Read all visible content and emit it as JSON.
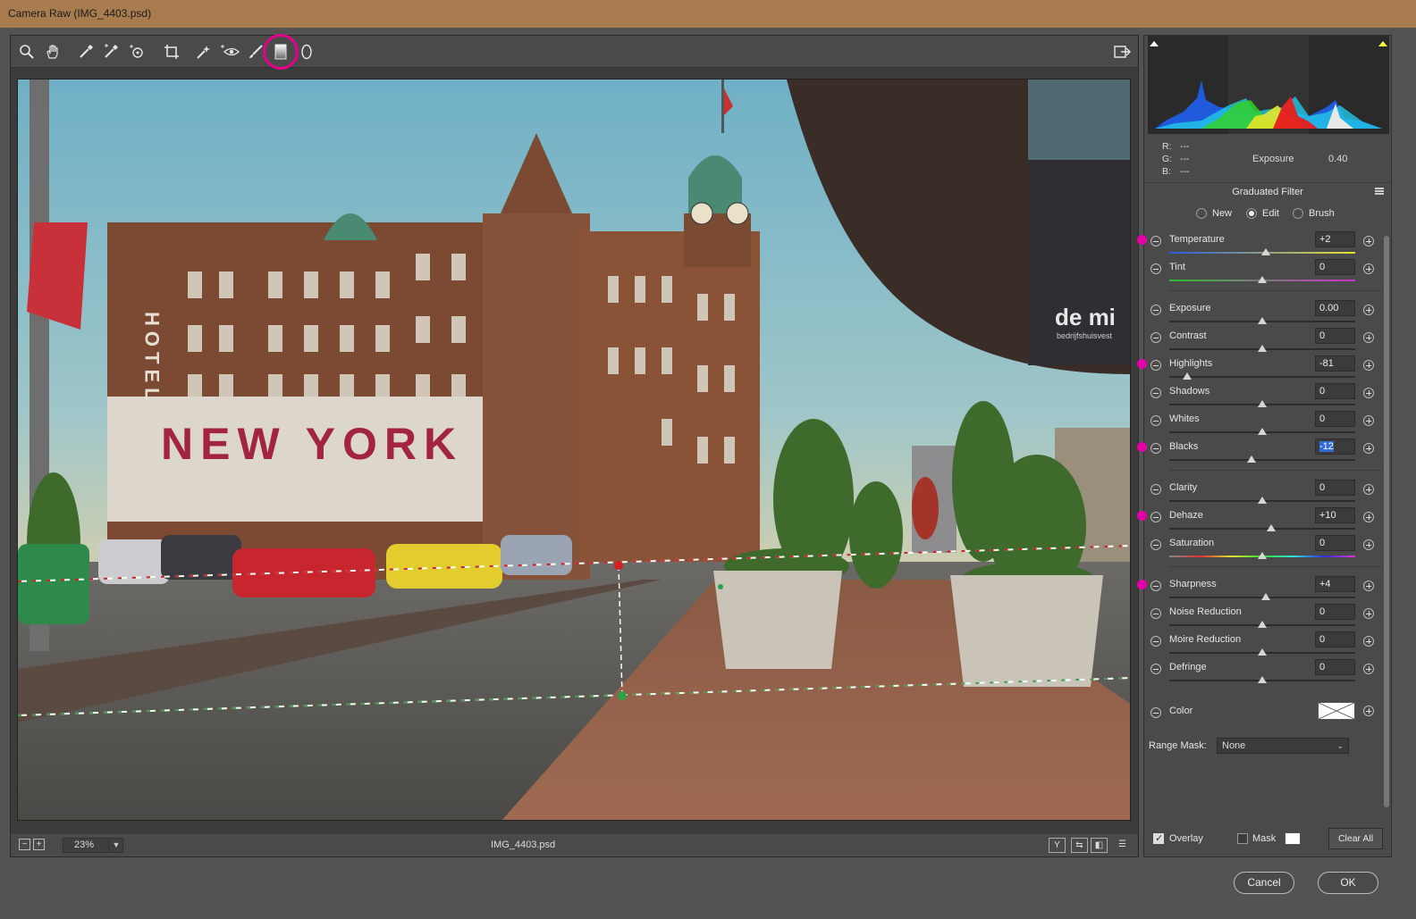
{
  "window": {
    "title": "Camera Raw (IMG_4403.psd)"
  },
  "toolbar": {
    "tools": [
      {
        "name": "zoom-tool",
        "glyph": "⌕"
      },
      {
        "name": "hand-tool",
        "glyph": "✋"
      },
      {
        "name": "white-balance-tool",
        "glyph": "✒"
      },
      {
        "name": "color-sampler-tool",
        "glyph": "✑"
      },
      {
        "name": "targeted-adjustment-tool",
        "glyph": "◎"
      },
      {
        "name": "crop-tool",
        "glyph": "⌗"
      },
      {
        "name": "spot-removal-tool",
        "glyph": "✧"
      },
      {
        "name": "red-eye-tool",
        "glyph": "⊹"
      },
      {
        "name": "adjustment-brush-tool",
        "glyph": "✎"
      },
      {
        "name": "graduated-filter-tool",
        "glyph": "▯"
      },
      {
        "name": "radial-filter-tool",
        "glyph": "○"
      }
    ],
    "export_glyph": "⇥"
  },
  "status": {
    "zoom": "23%",
    "filename": "IMG_4403.psd",
    "view_buttons": [
      "Y",
      "⇆",
      "◧",
      "☰"
    ]
  },
  "readout": {
    "r_label": "R:",
    "r_value": "---",
    "g_label": "G:",
    "g_value": "---",
    "b_label": "B:",
    "b_value": "---",
    "exposure_label": "Exposure",
    "exposure_value": "0.40"
  },
  "panel": {
    "title": "Graduated Filter",
    "modes": {
      "new": "New",
      "edit": "Edit",
      "brush": "Brush",
      "selected": "Edit"
    }
  },
  "sliders": [
    {
      "label": "Temperature",
      "value": "+2",
      "pos": 0.52,
      "pink": true,
      "track": "temp"
    },
    {
      "label": "Tint",
      "value": "0",
      "pos": 0.5,
      "pink": false,
      "track": "tint"
    },
    {
      "label": "Exposure",
      "value": "0.00",
      "pos": 0.5,
      "pink": false,
      "track": "gray"
    },
    {
      "label": "Contrast",
      "value": "0",
      "pos": 0.5,
      "pink": false,
      "track": "gray"
    },
    {
      "label": "Highlights",
      "value": "-81",
      "pos": 0.095,
      "pink": true,
      "track": "gray"
    },
    {
      "label": "Shadows",
      "value": "0",
      "pos": 0.5,
      "pink": false,
      "track": "gray"
    },
    {
      "label": "Whites",
      "value": "0",
      "pos": 0.5,
      "pink": false,
      "track": "gray"
    },
    {
      "label": "Blacks",
      "value": "-12",
      "pos": 0.44,
      "pink": true,
      "track": "gray",
      "selected": true
    },
    {
      "label": "Clarity",
      "value": "0",
      "pos": 0.5,
      "pink": false,
      "track": "gray"
    },
    {
      "label": "Dehaze",
      "value": "+10",
      "pos": 0.55,
      "pink": true,
      "track": "gray"
    },
    {
      "label": "Saturation",
      "value": "0",
      "pos": 0.5,
      "pink": false,
      "track": "sat"
    },
    {
      "label": "Sharpness",
      "value": "+4",
      "pos": 0.52,
      "pink": true,
      "track": "gray"
    },
    {
      "label": "Noise Reduction",
      "value": "0",
      "pos": 0.5,
      "pink": false,
      "track": "gray"
    },
    {
      "label": "Moire Reduction",
      "value": "0",
      "pos": 0.5,
      "pink": false,
      "track": "gray"
    },
    {
      "label": "Defringe",
      "value": "0",
      "pos": 0.5,
      "pink": false,
      "track": "gray"
    }
  ],
  "color": {
    "label": "Color"
  },
  "range_mask": {
    "label": "Range Mask:",
    "value": "None"
  },
  "bottom": {
    "overlay": "Overlay",
    "mask": "Mask",
    "clear_all": "Clear All"
  },
  "buttons": {
    "cancel": "Cancel",
    "ok": "OK"
  },
  "photo_text": {
    "hotel": "HOTEL",
    "newyork": "NEW YORK",
    "sign": "de mi",
    "sign_sub": "bedrijfshuisvest"
  },
  "colors": {
    "accent_pink": "#e400a8",
    "titlebar": "#a97c4f"
  }
}
